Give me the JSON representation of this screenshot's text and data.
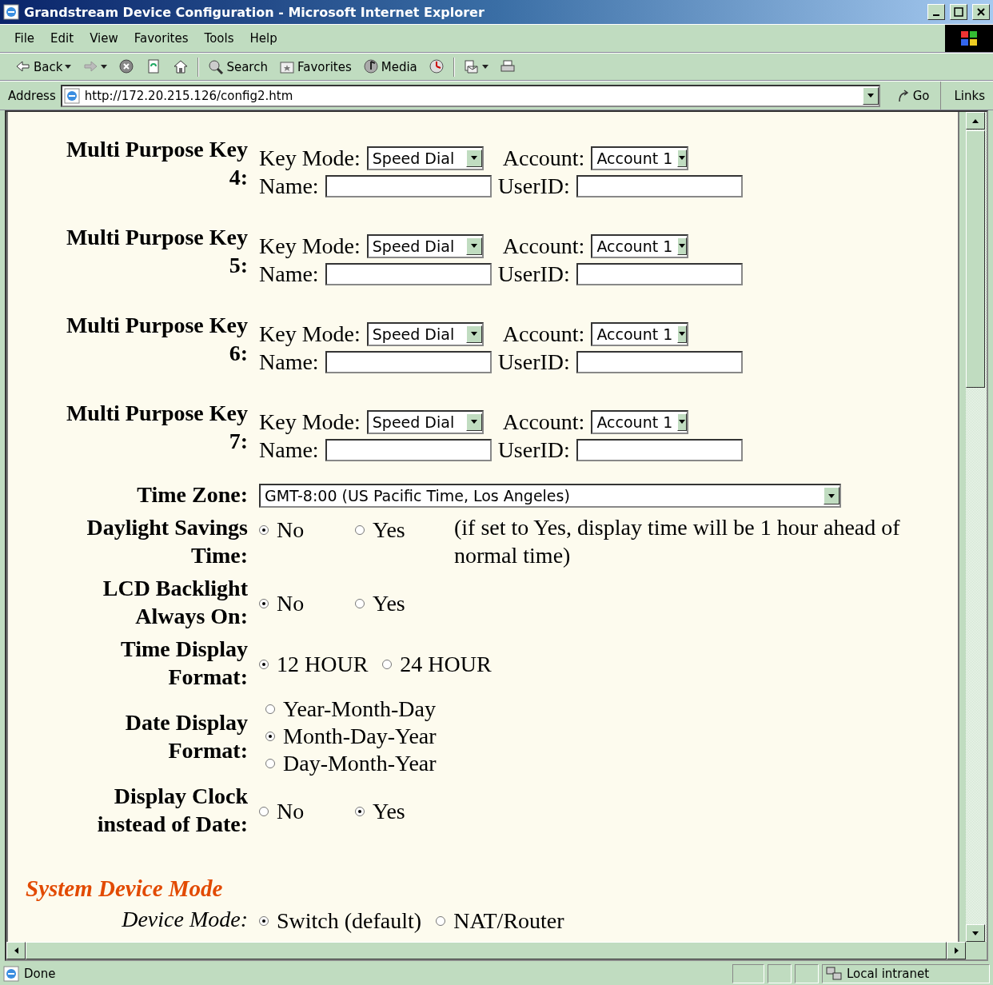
{
  "window": {
    "title": "Grandstream Device Configuration - Microsoft Internet Explorer"
  },
  "menu": [
    "File",
    "Edit",
    "View",
    "Favorites",
    "Tools",
    "Help"
  ],
  "toolbar": [
    {
      "kind": "back",
      "label": "Back"
    },
    {
      "kind": "forward"
    },
    {
      "kind": "stop"
    },
    {
      "kind": "refresh"
    },
    {
      "kind": "home"
    },
    {
      "kind": "search",
      "label": "Search"
    },
    {
      "kind": "favorites",
      "label": "Favorites"
    },
    {
      "kind": "media",
      "label": "Media"
    },
    {
      "kind": "history"
    },
    {
      "kind": "mail"
    },
    {
      "kind": "print"
    }
  ],
  "address_bar": {
    "label": "Address",
    "value": "http://172.20.215.126/config2.htm",
    "go": "Go",
    "links": "Links"
  },
  "multi_purpose_keys": [
    {
      "label": "Multi Purpose Key 4:",
      "key_mode_label": "Key Mode:",
      "key_mode": "Speed Dial",
      "account_label": "Account:",
      "account": "Account 1",
      "name_label": "Name:",
      "userid_label": "UserID:"
    },
    {
      "label": "Multi Purpose Key 5:",
      "key_mode_label": "Key Mode:",
      "key_mode": "Speed Dial",
      "account_label": "Account:",
      "account": "Account 1",
      "name_label": "Name:",
      "userid_label": "UserID:"
    },
    {
      "label": "Multi Purpose Key 6:",
      "key_mode_label": "Key Mode:",
      "key_mode": "Speed Dial",
      "account_label": "Account:",
      "account": "Account 1",
      "name_label": "Name:",
      "userid_label": "UserID:"
    },
    {
      "label": "Multi Purpose Key 7:",
      "key_mode_label": "Key Mode:",
      "key_mode": "Speed Dial",
      "account_label": "Account:",
      "account": "Account 1",
      "name_label": "Name:",
      "userid_label": "UserID:"
    }
  ],
  "settings": [
    {
      "kind": "select",
      "label": "Time Zone:",
      "value": "GMT-8:00 (US Pacific Time, Los Angeles)"
    },
    {
      "kind": "radio",
      "label": "Daylight Savings Time:",
      "options": [
        {
          "label": "No",
          "selected": true
        },
        {
          "label": "Yes",
          "selected": false
        }
      ],
      "note": "(if set to Yes, display time will be 1 hour ahead of normal time)"
    },
    {
      "kind": "radio",
      "label": "LCD Backlight Always On:",
      "options": [
        {
          "label": "No",
          "selected": true
        },
        {
          "label": "Yes",
          "selected": false
        }
      ]
    },
    {
      "kind": "radio",
      "label": "Time Display Format:",
      "options": [
        {
          "label": "12 HOUR",
          "selected": true
        },
        {
          "label": "24 HOUR",
          "selected": false
        }
      ]
    },
    {
      "kind": "radio_list",
      "label": "Date Display Format:",
      "options": [
        {
          "label": "Year-Month-Day",
          "selected": false
        },
        {
          "label": "Month-Day-Year",
          "selected": true
        },
        {
          "label": "Day-Month-Year",
          "selected": false
        }
      ]
    },
    {
      "kind": "radio",
      "label": "Display Clock instead of Date:",
      "options": [
        {
          "label": "No",
          "selected": false
        },
        {
          "label": "Yes",
          "selected": true
        }
      ]
    }
  ],
  "section": {
    "title": "System Device Mode",
    "label": "Device Mode:",
    "options": [
      {
        "label": "Switch (default)",
        "selected": true
      },
      {
        "label": "NAT/Router",
        "selected": false
      }
    ]
  },
  "status_bar": {
    "text": "Done",
    "zone": "Local intranet"
  }
}
